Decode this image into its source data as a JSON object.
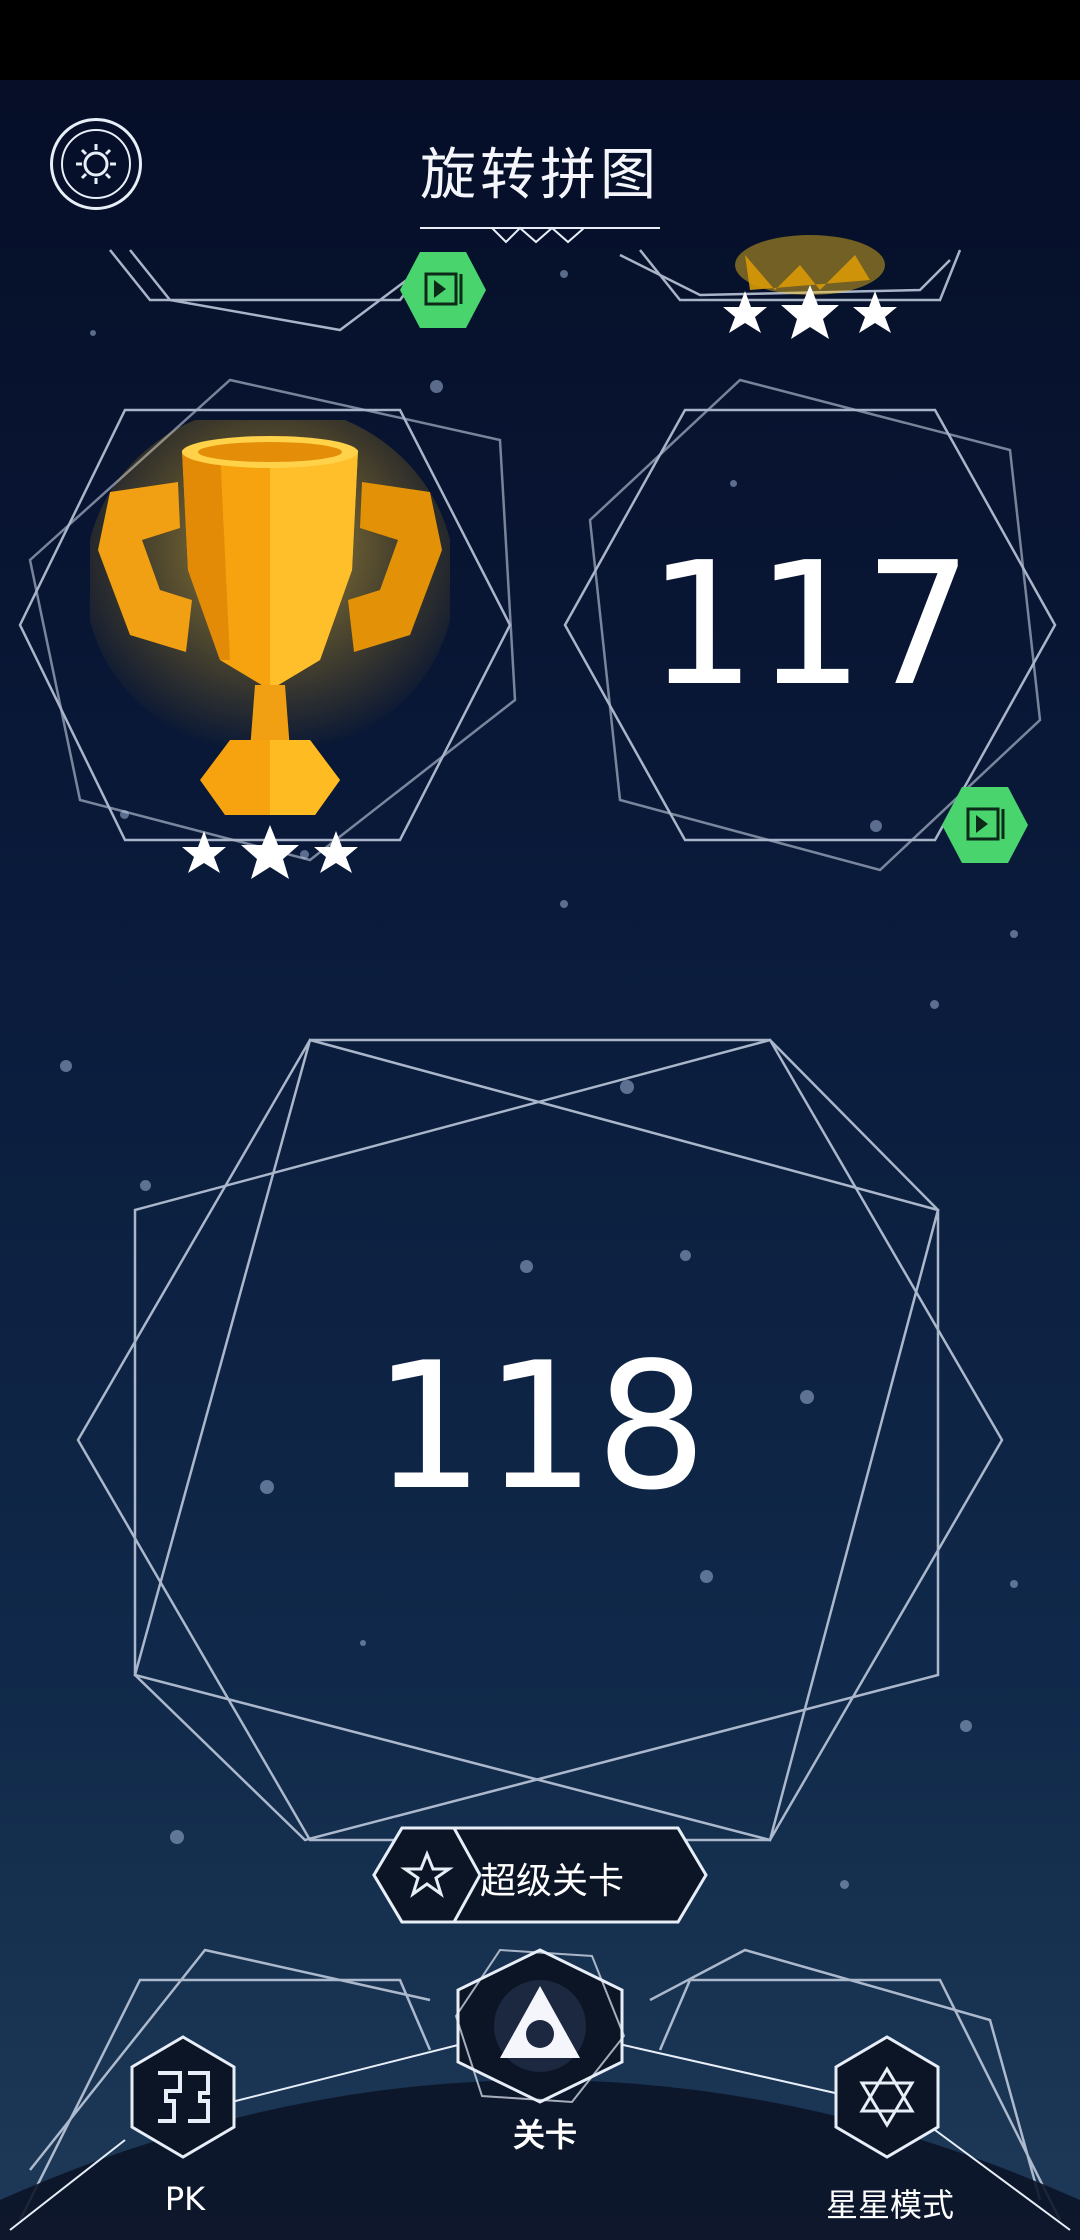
{
  "app": {
    "title": "旋转拼图"
  },
  "levels": {
    "current_number": "118",
    "next_number": "117"
  },
  "completed": {
    "stars": 3
  },
  "super_level": {
    "label": "超级关卡"
  },
  "nav": {
    "pk_label": "PK",
    "level_label": "关卡",
    "star_mode_label": "星星模式"
  },
  "colors": {
    "video_badge": "#4ad46e",
    "accent_gold": "#f6a30f",
    "line": "#c8d2e4"
  },
  "icons": {
    "settings": "gear-icon",
    "video": "video-ad-icon",
    "super": "star-icon",
    "pk": "pk-icon",
    "level": "triangle-icon",
    "star_mode": "star-of-david-icon"
  }
}
